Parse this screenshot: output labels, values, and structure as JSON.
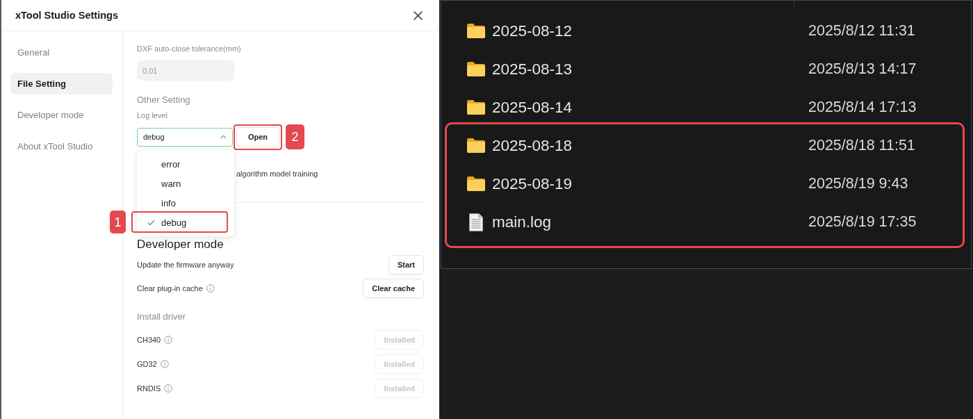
{
  "settings_window": {
    "title": "xTool Studio Settings"
  },
  "sidebar": {
    "items": [
      {
        "label": "General",
        "selected": false
      },
      {
        "label": "File Setting",
        "selected": true
      },
      {
        "label": "Developer mode",
        "selected": false
      },
      {
        "label": "About xTool Studio",
        "selected": false
      }
    ]
  },
  "file_setting": {
    "dxf_tolerance": {
      "label": "DXF auto-close tolerance(mm)",
      "value": "0.01"
    }
  },
  "other_setting": {
    "heading": "Other Setting",
    "log_level": {
      "label": "Log level",
      "value": "debug",
      "expanded": true,
      "options": [
        {
          "label": "error",
          "selected": false
        },
        {
          "label": "warn",
          "selected": false
        },
        {
          "label": "info",
          "selected": false
        },
        {
          "label": "debug",
          "selected": true,
          "callout": "1"
        }
      ]
    },
    "open_button": {
      "label": "Open",
      "callout": "2"
    },
    "partly_covered_text": "algorithm model training"
  },
  "developer_mode": {
    "heading": "Developer mode",
    "rows": [
      {
        "label": "Update the firmware anyway",
        "info": false,
        "button": "Start"
      },
      {
        "label": "Clear plug-in cache",
        "info": true,
        "button": "Clear cache"
      }
    ]
  },
  "install_driver": {
    "heading": "Install driver",
    "drivers": [
      {
        "name": "CH340",
        "button": "Installed",
        "disabled": true
      },
      {
        "name": "GD32",
        "button": "Installed",
        "disabled": true
      },
      {
        "name": "RNDIS",
        "button": "Installed",
        "disabled": true
      }
    ]
  },
  "file_explorer": {
    "entries": [
      {
        "kind": "folder",
        "name": "2025-08-12",
        "modified": "2025/8/12 11:31",
        "highlighted": false
      },
      {
        "kind": "folder",
        "name": "2025-08-13",
        "modified": "2025/8/13 14:17",
        "highlighted": false
      },
      {
        "kind": "folder",
        "name": "2025-08-14",
        "modified": "2025/8/14 17:13",
        "highlighted": false
      },
      {
        "kind": "folder",
        "name": "2025-08-18",
        "modified": "2025/8/18 11:51",
        "highlighted": true
      },
      {
        "kind": "folder",
        "name": "2025-08-19",
        "modified": "2025/8/19 9:43",
        "highlighted": true
      },
      {
        "kind": "file",
        "name": "main.log",
        "modified": "2025/8/19 17:35",
        "highlighted": true
      }
    ]
  }
}
